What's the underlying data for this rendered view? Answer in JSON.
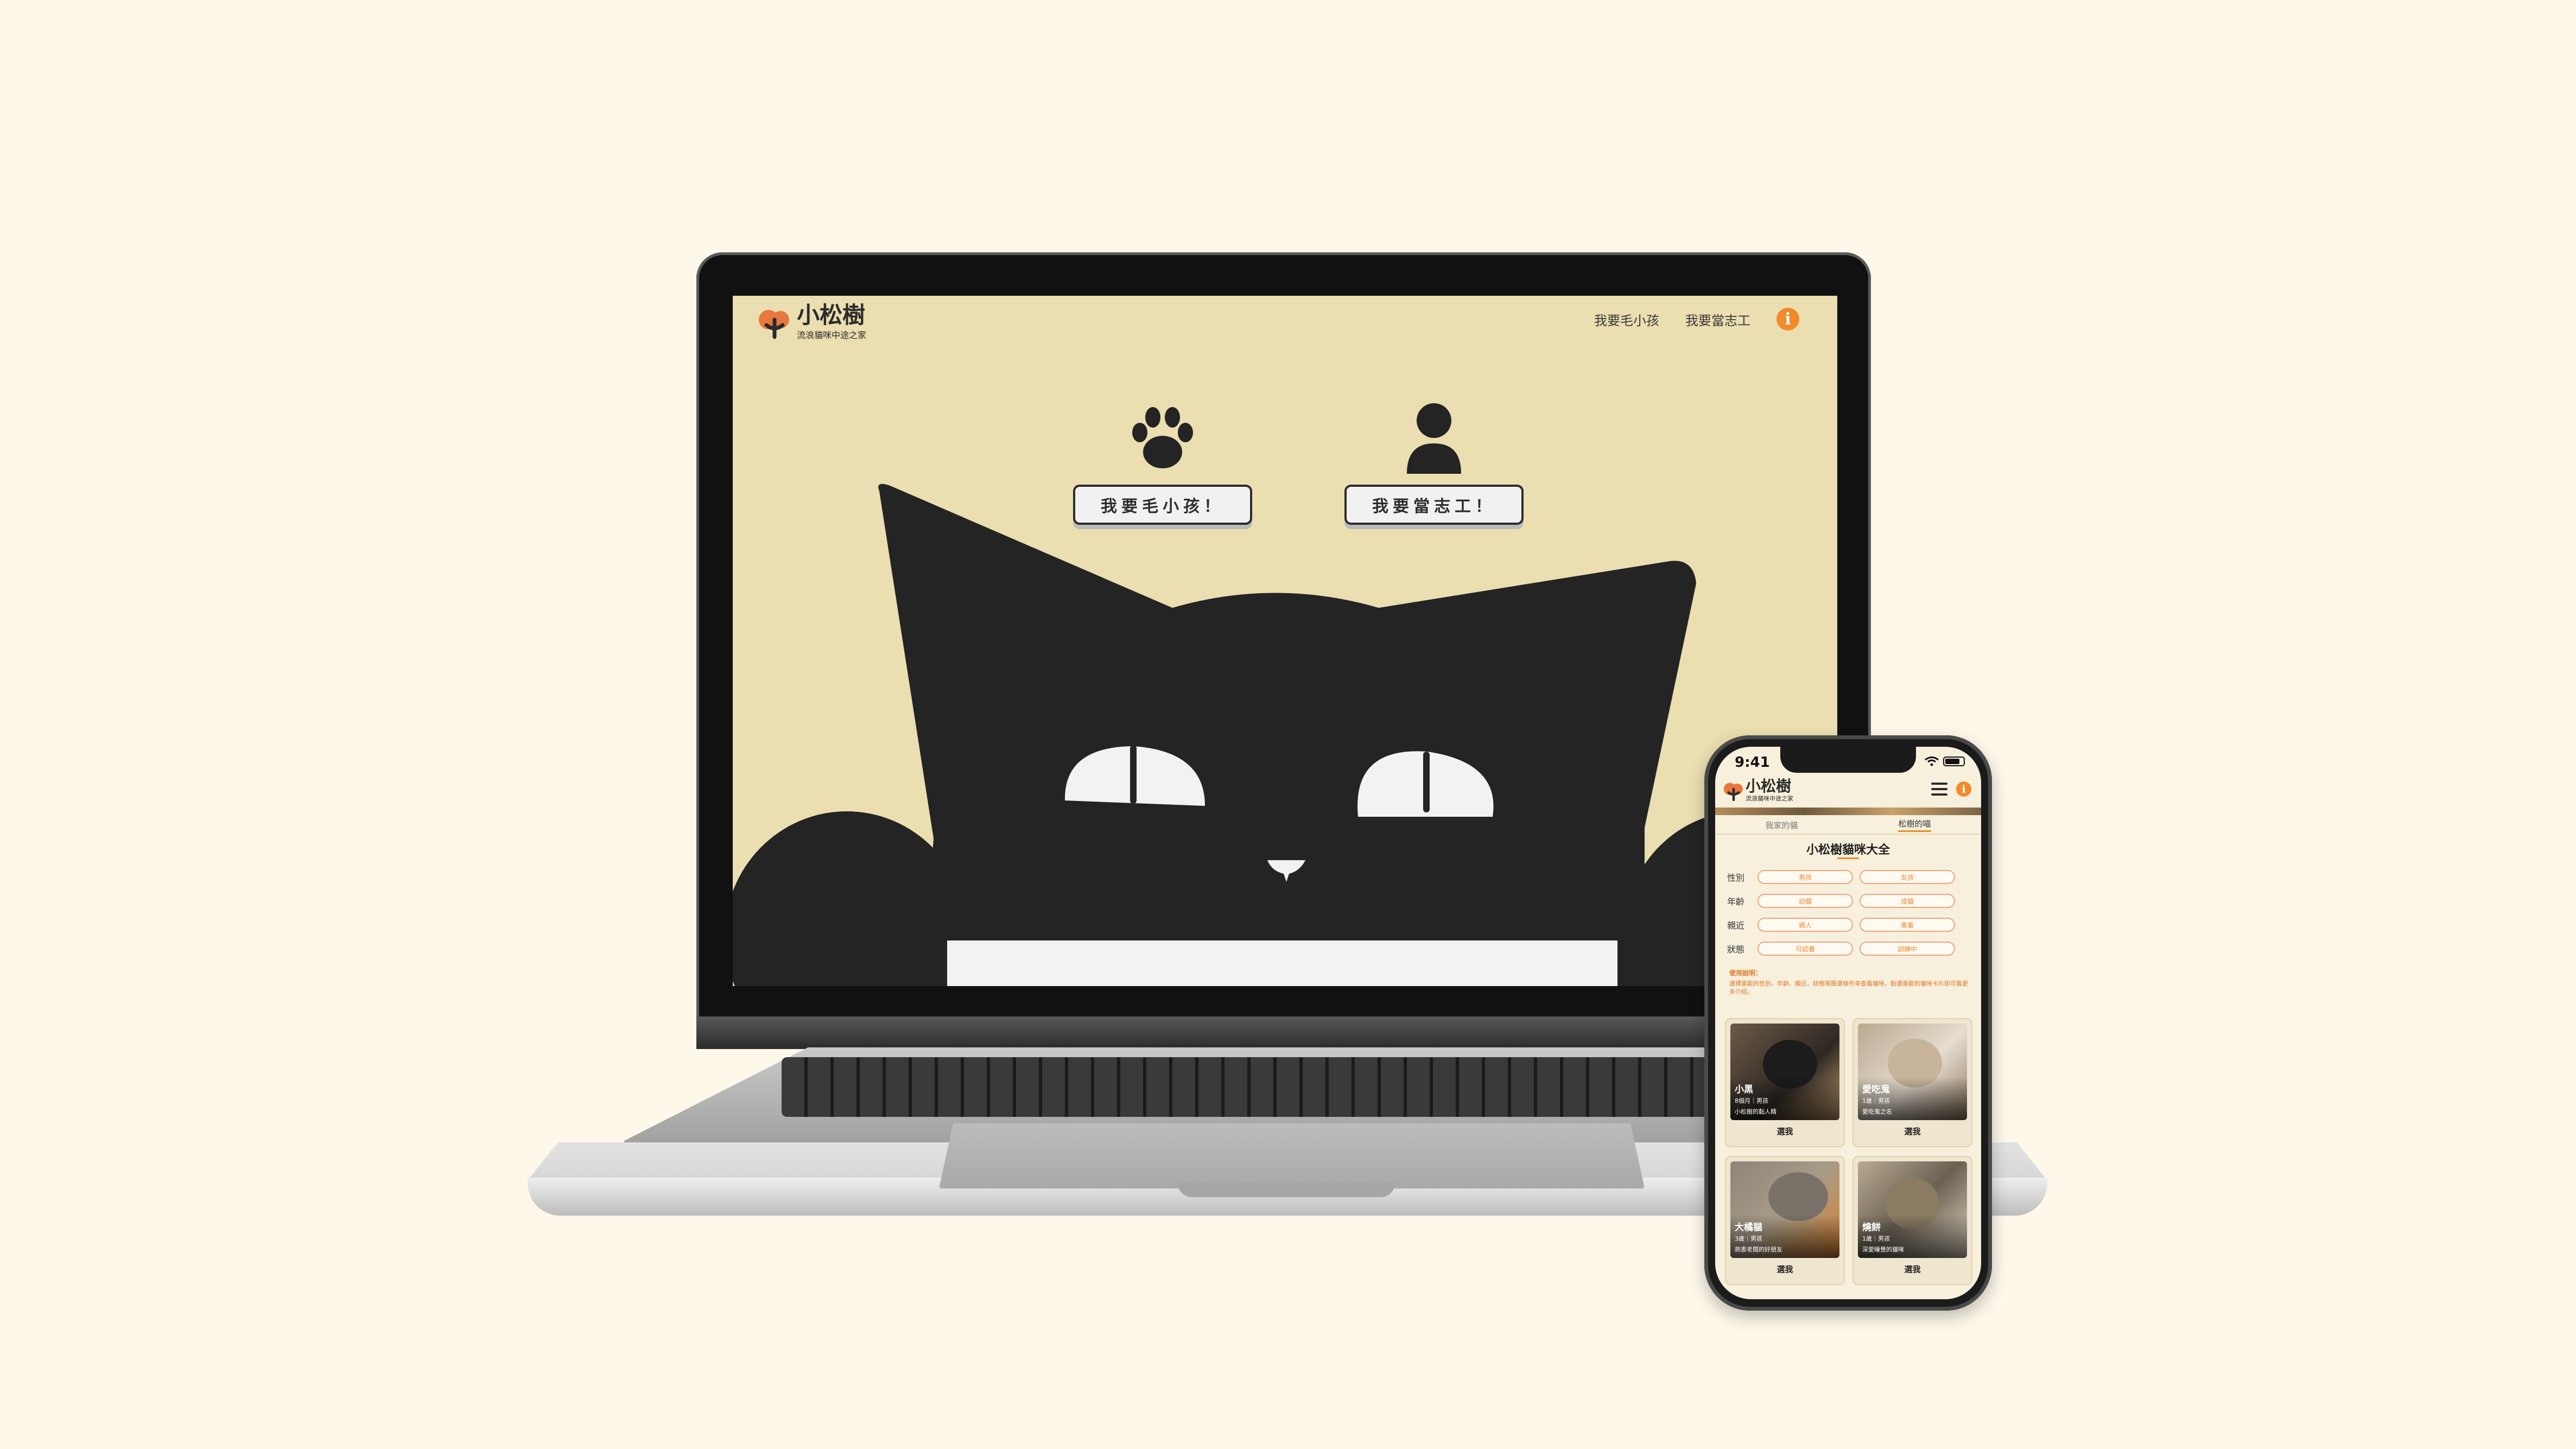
{
  "laptop": {
    "logo": {
      "title": "小松樹",
      "subtitle": "流浪貓咪中途之家"
    },
    "nav": {
      "adopt": "我要毛小孩",
      "volunteer": "我要當志工",
      "info": "i"
    },
    "cta": {
      "adopt_button": "我要毛小孩！",
      "volunteer_button": "我要當志工！"
    }
  },
  "phone": {
    "status": {
      "time": "9:41"
    },
    "logo": {
      "title": "小松樹",
      "subtitle": "流浪貓咪中途之家"
    },
    "info": "i",
    "tabs": [
      {
        "label": "我家的貓"
      },
      {
        "label": "松樹的喵"
      }
    ],
    "title": "小松樹貓咪大全",
    "filters": [
      {
        "label": "性別",
        "options": [
          "男孩",
          "女孩"
        ]
      },
      {
        "label": "年齡",
        "options": [
          "幼貓",
          "成貓"
        ]
      },
      {
        "label": "親近",
        "options": [
          "親人",
          "害羞"
        ]
      },
      {
        "label": "狀態",
        "options": [
          "可認養",
          "訓練中"
        ]
      }
    ],
    "note": {
      "title": "使用說明：",
      "text": "選擇喜歡的性別、年齡、親近、狀態等篩選條件來查看貓咪，點選喜歡的貓咪卡片即可看更多介紹。"
    },
    "cats": [
      {
        "name": "小黑",
        "meta": "8個月｜男孩",
        "desc": "小松樹的黏人精",
        "choose": "選我"
      },
      {
        "name": "愛吃鬼",
        "meta": "1歲｜男孩",
        "desc": "愛吃鬼之名",
        "choose": "選我"
      },
      {
        "name": "大橘貓",
        "meta": "3歲｜男孩",
        "desc": "熱衷老闆的好朋友",
        "choose": "選我"
      },
      {
        "name": "燒餅",
        "meta": "1歲｜男孩",
        "desc": "深愛睡覺的貓咪",
        "choose": "選我"
      }
    ]
  },
  "colors": {
    "background": "#fdf8ea",
    "screen_bg": "#ebdeb0",
    "accent": "#f08a2a",
    "cat_black": "#242424"
  }
}
